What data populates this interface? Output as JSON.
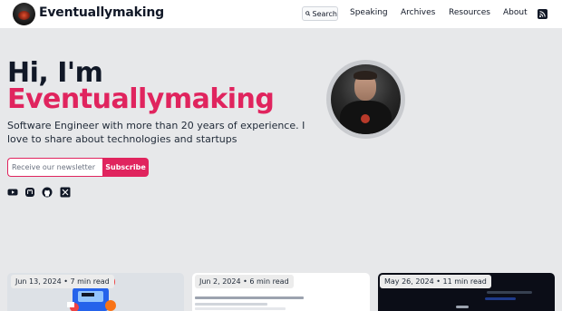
{
  "header": {
    "site_name": "Eventuallymaking",
    "search_label": "Search",
    "nav": [
      "Speaking",
      "Archives",
      "Resources",
      "About"
    ]
  },
  "hero": {
    "greeting": "Hi, I'm",
    "name": "Eventuallymaking",
    "bio": "Software Engineer with more than 20 years of experience. I love to share about technologies and startups",
    "newsletter_placeholder": "Receive our newsletter",
    "subscribe_label": "Subscribe",
    "social_icons": [
      "youtube-icon",
      "mastodon-icon",
      "github-icon",
      "x-icon"
    ]
  },
  "cards": [
    {
      "meta": "Jun 13, 2024 • 7 min read"
    },
    {
      "meta": "Jun 2, 2024 • 6 min read"
    },
    {
      "meta": "May 26, 2024 • 11 min read"
    }
  ],
  "colors": {
    "accent": "#e0245e",
    "hero_bg": "#e7e8ea",
    "text": "#111827"
  }
}
